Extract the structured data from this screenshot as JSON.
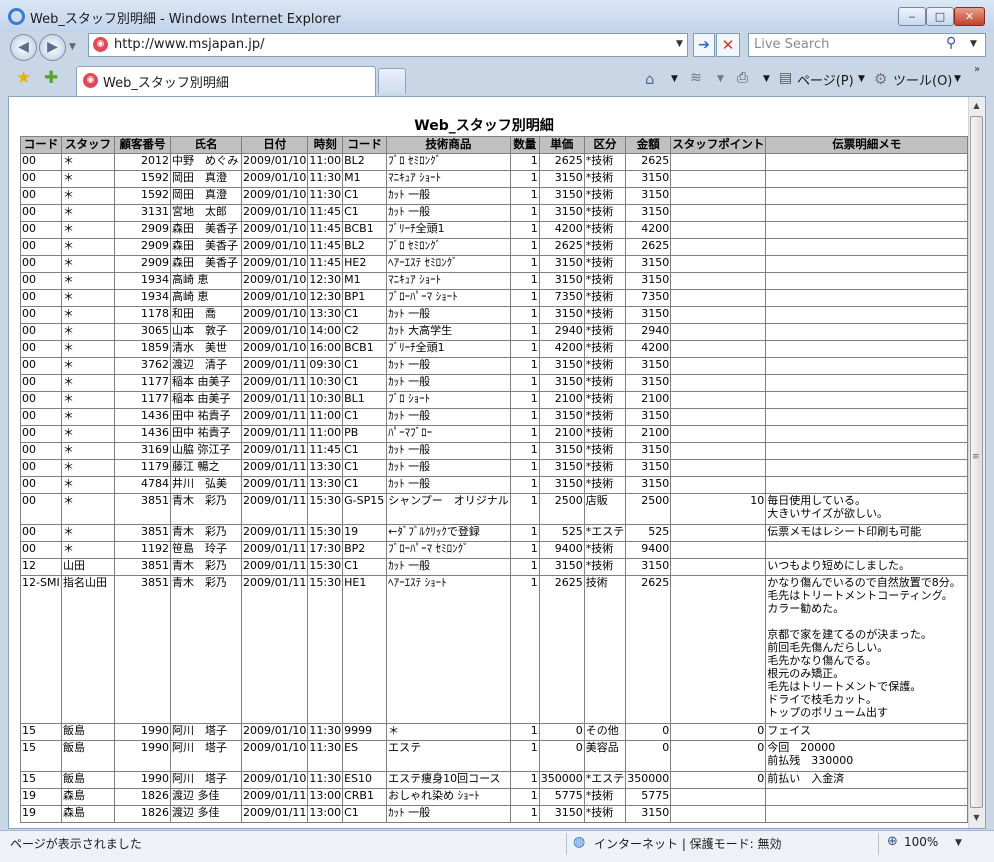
{
  "window": {
    "title": "Web_スタッフ別明細 - Windows Internet Explorer",
    "minimize_glyph": "‒",
    "maximize_glyph": "□",
    "close_glyph": "✕"
  },
  "nav": {
    "back_glyph": "◀",
    "forward_glyph": "▶",
    "address": "http://www.msjapan.jp/",
    "go_glyph": "➔",
    "stop_glyph": "✕",
    "search_placeholder": "Live Search",
    "search_glyph": "⚲",
    "dropdown_glyph": "▼"
  },
  "tabs": {
    "active_label": "Web_スタッフ別明細",
    "favorites_glyph": "★",
    "add_favorite_glyph": "✚"
  },
  "commands": {
    "home_glyph": "⌂",
    "feeds_glyph": "≋",
    "print_glyph": "⎙",
    "page_glyph": "▤",
    "page_label": "ページ(P)",
    "tools_glyph": "⚙",
    "tools_label": "ツール(O)",
    "more_glyph": "»"
  },
  "scrollbar": {
    "up_glyph": "▲",
    "down_glyph": "▼",
    "grip_glyph": "≡"
  },
  "page": {
    "heading": "Web_スタッフ別明細",
    "columns": [
      "コード",
      "スタッフ",
      "顧客番号",
      "氏名",
      "日付",
      "時刻",
      "コード",
      "技術商品",
      "数量",
      "単価",
      "区分",
      "金額",
      "スタッフポイント",
      "伝票明細メモ"
    ],
    "rows": [
      [
        "00",
        "＊",
        "2012",
        "中野　めぐみ",
        "2009/01/10",
        "11:00",
        "BL2",
        "ﾌﾞﾛ ｾﾐﾛﾝｸﾞ",
        "1",
        "2625",
        "*技術",
        "2625",
        "",
        ""
      ],
      [
        "00",
        "＊",
        "1592",
        "岡田　真澄",
        "2009/01/10",
        "11:30",
        "M1",
        "ﾏﾆｷｭｱ ｼｮｰﾄ",
        "1",
        "3150",
        "*技術",
        "3150",
        "",
        ""
      ],
      [
        "00",
        "＊",
        "1592",
        "岡田　真澄",
        "2009/01/10",
        "11:30",
        "C1",
        "ｶｯﾄ 一般",
        "1",
        "3150",
        "*技術",
        "3150",
        "",
        ""
      ],
      [
        "00",
        "＊",
        "3131",
        "宮地　太郎",
        "2009/01/10",
        "11:45",
        "C1",
        "ｶｯﾄ 一般",
        "1",
        "3150",
        "*技術",
        "3150",
        "",
        ""
      ],
      [
        "00",
        "＊",
        "2909",
        "森田　美香子",
        "2009/01/10",
        "11:45",
        "BCB1",
        "ﾌﾞﾘｰﾁ全頭1",
        "1",
        "4200",
        "*技術",
        "4200",
        "",
        ""
      ],
      [
        "00",
        "＊",
        "2909",
        "森田　美香子",
        "2009/01/10",
        "11:45",
        "BL2",
        "ﾌﾞﾛ ｾﾐﾛﾝｸﾞ",
        "1",
        "2625",
        "*技術",
        "2625",
        "",
        ""
      ],
      [
        "00",
        "＊",
        "2909",
        "森田　美香子",
        "2009/01/10",
        "11:45",
        "HE2",
        "ﾍｱｰｴｽﾃ ｾﾐﾛﾝｸﾞ",
        "1",
        "3150",
        "*技術",
        "3150",
        "",
        ""
      ],
      [
        "00",
        "＊",
        "1934",
        "高崎 恵",
        "2009/01/10",
        "12:30",
        "M1",
        "ﾏﾆｷｭｱ ｼｮｰﾄ",
        "1",
        "3150",
        "*技術",
        "3150",
        "",
        ""
      ],
      [
        "00",
        "＊",
        "1934",
        "高崎 恵",
        "2009/01/10",
        "12:30",
        "BP1",
        "ﾌﾞﾛｰﾊﾟｰﾏ ｼｮｰﾄ",
        "1",
        "7350",
        "*技術",
        "7350",
        "",
        ""
      ],
      [
        "00",
        "＊",
        "1178",
        "和田　喬",
        "2009/01/10",
        "13:30",
        "C1",
        "ｶｯﾄ 一般",
        "1",
        "3150",
        "*技術",
        "3150",
        "",
        ""
      ],
      [
        "00",
        "＊",
        "3065",
        "山本　敦子",
        "2009/01/10",
        "14:00",
        "C2",
        "ｶｯﾄ 大高学生",
        "1",
        "2940",
        "*技術",
        "2940",
        "",
        ""
      ],
      [
        "00",
        "＊",
        "1859",
        "清水　美世",
        "2009/01/10",
        "16:00",
        "BCB1",
        "ﾌﾞﾘｰﾁ全頭1",
        "1",
        "4200",
        "*技術",
        "4200",
        "",
        ""
      ],
      [
        "00",
        "＊",
        "3762",
        "渡辺　清子",
        "2009/01/11",
        "09:30",
        "C1",
        "ｶｯﾄ 一般",
        "1",
        "3150",
        "*技術",
        "3150",
        "",
        ""
      ],
      [
        "00",
        "＊",
        "1177",
        "稲本 由美子",
        "2009/01/11",
        "10:30",
        "C1",
        "ｶｯﾄ 一般",
        "1",
        "3150",
        "*技術",
        "3150",
        "",
        ""
      ],
      [
        "00",
        "＊",
        "1177",
        "稲本 由美子",
        "2009/01/11",
        "10:30",
        "BL1",
        "ﾌﾞﾛ ｼｮｰﾄ",
        "1",
        "2100",
        "*技術",
        "2100",
        "",
        ""
      ],
      [
        "00",
        "＊",
        "1436",
        "田中 祐貴子",
        "2009/01/11",
        "11:00",
        "C1",
        "ｶｯﾄ 一般",
        "1",
        "3150",
        "*技術",
        "3150",
        "",
        ""
      ],
      [
        "00",
        "＊",
        "1436",
        "田中 祐貴子",
        "2009/01/11",
        "11:00",
        "PB",
        "ﾊﾟｰﾏﾌﾞﾛｰ",
        "1",
        "2100",
        "*技術",
        "2100",
        "",
        ""
      ],
      [
        "00",
        "＊",
        "3169",
        "山脇 弥江子",
        "2009/01/11",
        "11:45",
        "C1",
        "ｶｯﾄ 一般",
        "1",
        "3150",
        "*技術",
        "3150",
        "",
        ""
      ],
      [
        "00",
        "＊",
        "1179",
        "藤江 暢之",
        "2009/01/11",
        "13:30",
        "C1",
        "ｶｯﾄ 一般",
        "1",
        "3150",
        "*技術",
        "3150",
        "",
        ""
      ],
      [
        "00",
        "＊",
        "4784",
        "井川　弘美",
        "2009/01/11",
        "13:30",
        "C1",
        "ｶｯﾄ 一般",
        "1",
        "3150",
        "*技術",
        "3150",
        "",
        ""
      ],
      [
        "00",
        "＊",
        "3851",
        "青木　彩乃",
        "2009/01/11",
        "15:30",
        "G-SP15",
        "シャンプー　オリジナル",
        "1",
        "2500",
        "店販",
        "2500",
        "10",
        "毎日使用している。\n大きいサイズが欲しい。"
      ],
      [
        "00",
        "＊",
        "3851",
        "青木　彩乃",
        "2009/01/11",
        "15:30",
        "19",
        "←ﾀﾞﾌﾞﾙｸﾘｯｸで登録",
        "1",
        "525",
        "*エステ",
        "525",
        "",
        "伝票メモはレシート印刷も可能"
      ],
      [
        "00",
        "＊",
        "1192",
        "笹島　玲子",
        "2009/01/11",
        "17:30",
        "BP2",
        "ﾌﾞﾛｰﾊﾟｰﾏ ｾﾐﾛﾝｸﾞ",
        "1",
        "9400",
        "*技術",
        "9400",
        "",
        ""
      ],
      [
        "12",
        "山田",
        "3851",
        "青木　彩乃",
        "2009/01/11",
        "15:30",
        "C1",
        "ｶｯﾄ 一般",
        "1",
        "3150",
        "*技術",
        "3150",
        "",
        "いつもより短めにしました。"
      ],
      [
        "12-SMI",
        "指名山田",
        "3851",
        "青木　彩乃",
        "2009/01/11",
        "15:30",
        "HE1",
        "ﾍｱｰｴｽﾃ ｼｮｰﾄ",
        "1",
        "2625",
        "技術",
        "2625",
        "",
        "かなり傷んでいるので自然放置で8分。\n毛先はトリートメントコーティング。\nカラー勧めた。\n\n京都で家を建てるのが決まった。\n前回毛先傷んだらしい。\n毛先かなり傷んでる。\n根元のみ矯正。\n毛先はトリートメントで保護。\nドライで枝毛カット。\nトップのボリューム出す"
      ],
      [
        "15",
        "飯島",
        "1990",
        "阿川　塔子",
        "2009/01/10",
        "11:30",
        "9999",
        "＊",
        "1",
        "0",
        "その他",
        "0",
        "0",
        "フェイス"
      ],
      [
        "15",
        "飯島",
        "1990",
        "阿川　塔子",
        "2009/01/10",
        "11:30",
        "ES",
        "エステ",
        "1",
        "0",
        "美容品",
        "0",
        "0",
        "今回　20000\n前払残　330000"
      ],
      [
        "15",
        "飯島",
        "1990",
        "阿川　塔子",
        "2009/01/10",
        "11:30",
        "ES10",
        "エステ痩身10回コース",
        "1",
        "350000",
        "*エステ",
        "350000",
        "0",
        "前払い　入金済"
      ],
      [
        "19",
        "森島",
        "1826",
        "渡辺 多佳",
        "2009/01/11",
        "13:00",
        "CRB1",
        "おしゃれ染め ｼｮｰﾄ",
        "1",
        "5775",
        "*技術",
        "5775",
        "",
        ""
      ],
      [
        "19",
        "森島",
        "1826",
        "渡辺 多佳",
        "2009/01/11",
        "13:00",
        "C1",
        "ｶｯﾄ 一般",
        "1",
        "3150",
        "*技術",
        "3150",
        "",
        ""
      ]
    ]
  },
  "status": {
    "text": "ページが表示されました",
    "globe_glyph": "◍",
    "zone": "インターネット | 保護モード: 無効",
    "zoom_glyph": "⊕",
    "zoom": "100%"
  }
}
